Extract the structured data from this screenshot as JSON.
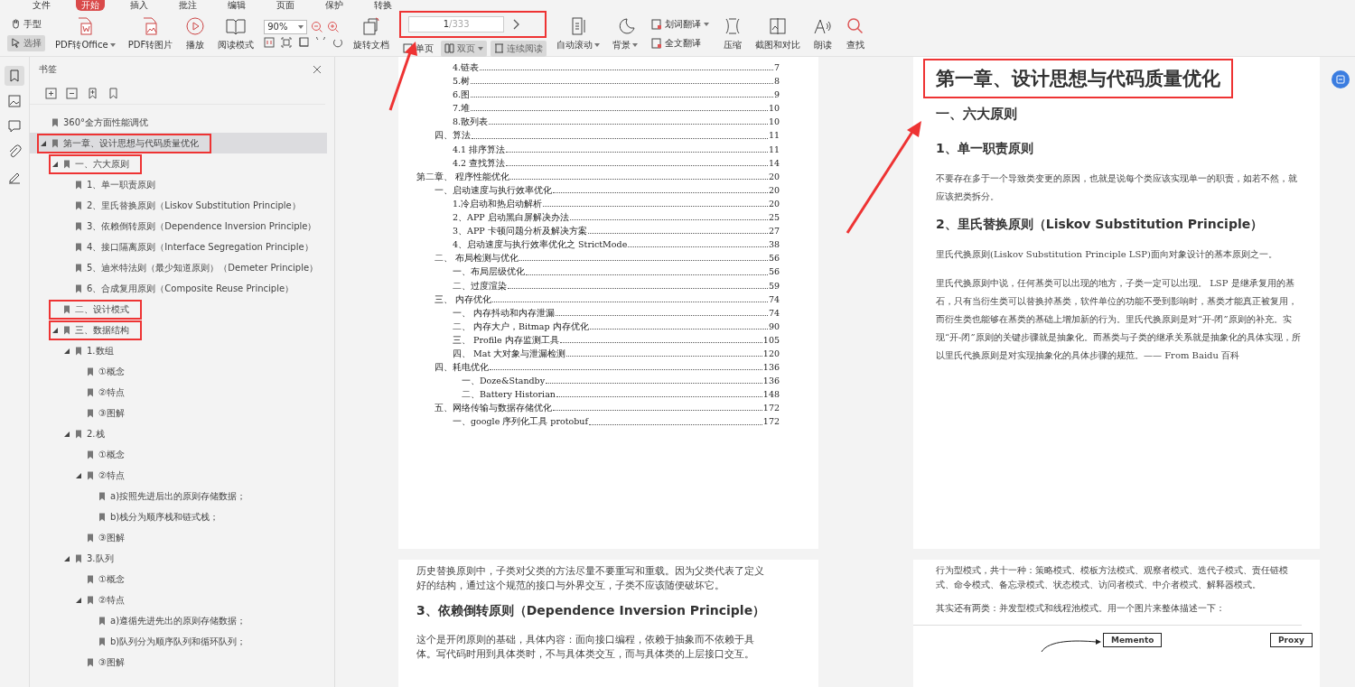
{
  "menu_tabs": [
    {
      "label": "文件",
      "selected": false
    },
    {
      "label": "开始",
      "selected": true
    },
    {
      "label": "插入",
      "selected": false
    },
    {
      "label": "批注",
      "selected": false
    },
    {
      "label": "编辑",
      "selected": false
    },
    {
      "label": "页面",
      "selected": false
    },
    {
      "label": "保护",
      "selected": false
    },
    {
      "label": "转换",
      "selected": false
    }
  ],
  "toolbar": {
    "cursor_modes": [
      {
        "label": "手型",
        "selected": false
      },
      {
        "label": "选择",
        "selected": true
      }
    ],
    "convert_tools": [
      {
        "label": "PDF转Office",
        "dropdown": true
      },
      {
        "label": "PDF转图片",
        "dropdown": false
      },
      {
        "label": "播放",
        "dropdown": false
      },
      {
        "label": "阅读模式",
        "dropdown": false
      }
    ],
    "zoom": {
      "value": "90%"
    },
    "rotate": {
      "label": "旋转文档"
    },
    "page_nav": {
      "current": "1",
      "total": "/333",
      "highlighted": true
    },
    "view_modes": [
      {
        "label": "单页",
        "selected": false,
        "dropdown": false
      },
      {
        "label": "双页",
        "selected": true,
        "dropdown": true
      },
      {
        "label": "连续阅读",
        "selected": true,
        "dropdown": false
      }
    ],
    "read_tools": [
      {
        "label": "自动滚动",
        "dropdown": true
      },
      {
        "label": "背景",
        "dropdown": true
      }
    ],
    "translate": [
      {
        "label": "划词翻译",
        "dropdown": true
      },
      {
        "label": "全文翻译",
        "dropdown": false
      }
    ],
    "extra_tools": [
      {
        "label": "压缩"
      },
      {
        "label": "截图和对比"
      },
      {
        "label": "朗读"
      },
      {
        "label": "查找"
      }
    ]
  },
  "sidebar": {
    "title": "书签",
    "items": [
      {
        "label": "360°全方面性能调优",
        "selected": false,
        "highlighted": false
      },
      {
        "label": "第一章、设计思想与代码质量优化",
        "selected": true,
        "highlighted": true,
        "expanded": true,
        "children": [
          {
            "label": "一、六大原则",
            "selected": false,
            "highlighted": true,
            "expanded": true,
            "children": [
              {
                "label": "1、单一职责原则",
                "selected": false,
                "highlighted": false
              },
              {
                "label": "2、里氏替换原则（Liskov Substitution Principle）",
                "selected": false,
                "highlighted": false
              },
              {
                "label": "3、依赖倒转原则（Dependence Inversion Principle）",
                "selected": false,
                "highlighted": false
              },
              {
                "label": "4、接口隔离原则（Interface Segregation Principle）",
                "selected": false,
                "highlighted": false
              },
              {
                "label": "5、迪米特法则（最少知道原则）（Demeter Principle）",
                "selected": false,
                "highlighted": false
              },
              {
                "label": "6、合成复用原则（Composite Reuse Principle）",
                "selected": false,
                "highlighted": false
              }
            ]
          },
          {
            "label": "二、设计模式",
            "selected": false,
            "highlighted": true
          },
          {
            "label": "三、数据结构",
            "selected": false,
            "highlighted": true,
            "expanded": true,
            "children": [
              {
                "label": "1.数组",
                "selected": false,
                "highlighted": false,
                "expanded": true,
                "children": [
                  {
                    "label": "①概念",
                    "selected": false,
                    "highlighted": false
                  },
                  {
                    "label": "②特点",
                    "selected": false,
                    "highlighted": false
                  },
                  {
                    "label": "③图解",
                    "selected": false,
                    "highlighted": false
                  }
                ]
              },
              {
                "label": "2.栈",
                "selected": false,
                "highlighted": false,
                "expanded": true,
                "children": [
                  {
                    "label": "①概念",
                    "selected": false,
                    "highlighted": false
                  },
                  {
                    "label": "②特点",
                    "selected": false,
                    "highlighted": false,
                    "expanded": true,
                    "children": [
                      {
                        "label": "a)按照先进后出的原则存储数据；",
                        "selected": false,
                        "highlighted": false
                      },
                      {
                        "label": "b)栈分为顺序栈和链式栈；",
                        "selected": false,
                        "highlighted": false
                      }
                    ]
                  },
                  {
                    "label": "③图解",
                    "selected": false,
                    "highlighted": false
                  }
                ]
              },
              {
                "label": "3.队列",
                "selected": false,
                "highlighted": false,
                "expanded": true,
                "children": [
                  {
                    "label": "①概念",
                    "selected": false,
                    "highlighted": false
                  },
                  {
                    "label": "②特点",
                    "selected": false,
                    "highlighted": false,
                    "expanded": true,
                    "children": [
                      {
                        "label": "a)遵循先进先出的原则存储数据；",
                        "selected": false,
                        "highlighted": false
                      },
                      {
                        "label": "b)队列分为顺序队列和循环队列；",
                        "selected": false,
                        "highlighted": false
                      }
                    ]
                  },
                  {
                    "label": "③图解",
                    "selected": false,
                    "highlighted": false
                  }
                ]
              }
            ]
          }
        ]
      }
    ]
  },
  "toc_page": {
    "entries": [
      {
        "kind": "item",
        "text": "4.链表",
        "page": "7"
      },
      {
        "kind": "item",
        "text": "5.树",
        "page": "8"
      },
      {
        "kind": "item",
        "text": "6.图",
        "page": "9"
      },
      {
        "kind": "item",
        "text": "7.堆",
        "page": "10"
      },
      {
        "kind": "item",
        "text": "8.散列表",
        "page": "10"
      },
      {
        "kind": "section",
        "text": "四、算法",
        "page": "11"
      },
      {
        "kind": "item",
        "text": "4.1 排序算法",
        "page": "11"
      },
      {
        "kind": "item",
        "text": "4.2 查找算法",
        "page": "14"
      },
      {
        "kind": "chapter",
        "text": "第二章、 程序性能优化",
        "page": "20"
      },
      {
        "kind": "section",
        "text": "一、启动速度与执行效率优化",
        "page": "20"
      },
      {
        "kind": "item",
        "text": "1.冷启动和热启动解析",
        "page": "20"
      },
      {
        "kind": "item",
        "text": "2、APP 启动黑白屏解决办法",
        "page": "25"
      },
      {
        "kind": "item",
        "text": "3、APP 卡顿问题分析及解决方案",
        "page": "27"
      },
      {
        "kind": "item",
        "text": "4、启动速度与执行效率优化之 StrictMode",
        "page": "38"
      },
      {
        "kind": "section",
        "text": "二、 布局检测与优化",
        "page": "56"
      },
      {
        "kind": "item",
        "text": "一、布局层级优化",
        "page": "56"
      },
      {
        "kind": "item",
        "text": "二、过度渲染",
        "page": "59"
      },
      {
        "kind": "section",
        "text": "三、 内存优化",
        "page": "74"
      },
      {
        "kind": "item",
        "text": "一、 内存抖动和内存泄漏",
        "page": "74"
      },
      {
        "kind": "item",
        "text": "二、 内存大户，Bitmap 内存优化",
        "page": "90"
      },
      {
        "kind": "item",
        "text": "三、 Profile 内存监测工具",
        "page": "105"
      },
      {
        "kind": "item",
        "text": "四、 Mat 大对象与泄漏检测",
        "page": "120"
      },
      {
        "kind": "section",
        "text": "四、耗电优化",
        "page": "136"
      },
      {
        "kind": "subitem",
        "text": "一、Doze&Standby",
        "page": "136"
      },
      {
        "kind": "subitem",
        "text": "二、Battery Historian",
        "page": "148"
      },
      {
        "kind": "section",
        "text": "五、网络传输与数据存储优化",
        "page": "172"
      },
      {
        "kind": "item",
        "text": "一、google 序列化工具 protobuf",
        "page": "172"
      }
    ]
  },
  "right_page": {
    "title": "第一章、设计思想与代码质量优化",
    "title_highlighted": true,
    "blocks": [
      {
        "kind": "h2",
        "text": "一、六大原则"
      },
      {
        "kind": "h3",
        "text": "1、单一职责原则"
      },
      {
        "kind": "p",
        "text": "不要存在多于一个导致类变更的原因，也就是说每个类应该实现单一的职责，如若不然，就应该把类拆分。"
      },
      {
        "kind": "h3",
        "text": "2、里氏替换原则（Liskov Substitution Principle）"
      },
      {
        "kind": "p",
        "text": "里氏代换原则(Liskov Substitution Principle LSP)面向对象设计的基本原则之一。"
      },
      {
        "kind": "p",
        "text": "里氏代换原则中说，任何基类可以出现的地方，子类一定可以出现。 LSP 是继承复用的基石，只有当衍生类可以替换掉基类，软件单位的功能不受到影响时，基类才能真正被复用，而衍生类也能够在基类的基础上增加新的行为。里氏代换原则是对“开-闭”原则的补充。实现“开-闭”原则的关键步骤就是抽象化。而基类与子类的继承关系就是抽象化的具体实现，所以里氏代换原则是对实现抽象化的具体步骤的规范。—— From Baidu 百科"
      }
    ]
  },
  "lower_left_page": {
    "blocks": [
      {
        "kind": "p",
        "text": "历史替换原则中，子类对父类的方法尽量不要重写和重载。因为父类代表了定义好的结构，通过这个规范的接口与外界交互，子类不应该随便破坏它。"
      },
      {
        "kind": "h3",
        "text": "3、依赖倒转原则（Dependence Inversion Principle）"
      },
      {
        "kind": "p",
        "text": "这个是开闭原则的基础，具体内容：面向接口编程，依赖于抽象而不依赖于具体。写代码时用到具体类时，不与具体类交互，而与具体类的上层接口交互。"
      }
    ]
  },
  "lower_right_page": {
    "blocks": [
      {
        "kind": "p",
        "text": "行为型模式，共十一种：策略模式、模板方法模式、观察者模式、迭代子模式、责任链模式、命令模式、备忘录模式、状态模式、访问者模式、中介者模式、解释器模式。"
      },
      {
        "kind": "p",
        "text": "其实还有两类：并发型模式和线程池模式。用一个图片来整体描述一下："
      }
    ],
    "diagram_nodes": [
      "Memento",
      "Proxy"
    ]
  }
}
